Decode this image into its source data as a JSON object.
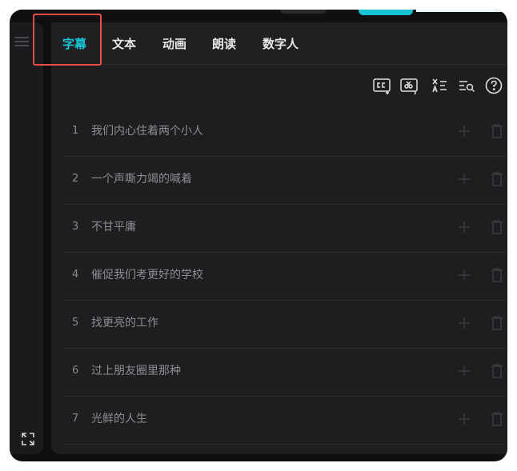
{
  "tabs": [
    {
      "label": "字幕",
      "active": true
    },
    {
      "label": "文本",
      "active": false
    },
    {
      "label": "动画",
      "active": false
    },
    {
      "label": "朗读",
      "active": false
    },
    {
      "label": "数字人",
      "active": false
    }
  ],
  "toolbar": {
    "icons": [
      "caption-recognize-icon",
      "caption-audio-icon",
      "translate-icon",
      "search-replace-icon",
      "help-icon"
    ]
  },
  "subtitles": [
    {
      "index": "1",
      "text": "我们内心住着两个小人"
    },
    {
      "index": "2",
      "text": "一个声嘶力竭的喊着"
    },
    {
      "index": "3",
      "text": "不甘平庸"
    },
    {
      "index": "4",
      "text": "催促我们考更好的学校"
    },
    {
      "index": "5",
      "text": "找更亮的工作"
    },
    {
      "index": "6",
      "text": "过上朋友圈里那种"
    },
    {
      "index": "7",
      "text": "光鲜的人生"
    }
  ],
  "colors": {
    "accent": "#19c8dc",
    "highlight": "#f14c4c",
    "panel": "#1e1e20",
    "text_dim": "#8d8d91"
  }
}
